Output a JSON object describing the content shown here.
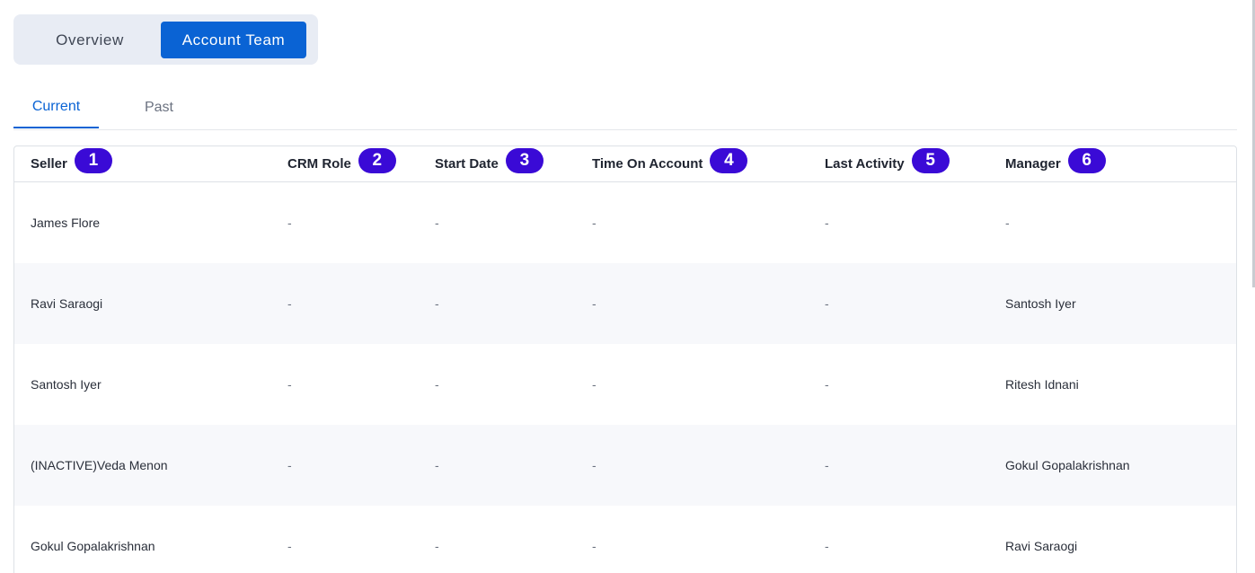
{
  "view_toggle": {
    "overview_label": "Overview",
    "account_team_label": "Account Team"
  },
  "subtabs": {
    "current_label": "Current",
    "past_label": "Past"
  },
  "table": {
    "columns": [
      {
        "label": "Seller",
        "badge": "1"
      },
      {
        "label": "CRM Role",
        "badge": "2"
      },
      {
        "label": "Start Date",
        "badge": "3"
      },
      {
        "label": "Time On Account",
        "badge": "4"
      },
      {
        "label": "Last Activity",
        "badge": "5"
      },
      {
        "label": "Manager",
        "badge": "6"
      }
    ],
    "rows": [
      {
        "seller": "James Flore",
        "crm_role": "-",
        "start_date": "-",
        "time_on_account": "-",
        "last_activity": "-",
        "manager": "-"
      },
      {
        "seller": "Ravi Saraogi",
        "crm_role": "-",
        "start_date": "-",
        "time_on_account": "-",
        "last_activity": "-",
        "manager": "Santosh Iyer"
      },
      {
        "seller": "Santosh Iyer",
        "crm_role": "-",
        "start_date": "-",
        "time_on_account": "-",
        "last_activity": "-",
        "manager": "Ritesh Idnani"
      },
      {
        "seller": "(INACTIVE)Veda Menon",
        "crm_role": "-",
        "start_date": "-",
        "time_on_account": "-",
        "last_activity": "-",
        "manager": "Gokul Gopalakrishnan"
      },
      {
        "seller": "Gokul Gopalakrishnan",
        "crm_role": "-",
        "start_date": "-",
        "time_on_account": "-",
        "last_activity": "-",
        "manager": "Ravi Saraogi"
      }
    ]
  },
  "colors": {
    "primary": "#0a63d4",
    "badge": "#3a0ad6",
    "toggle_bg": "#e8ecf4",
    "alt_row": "#f7f8fb"
  }
}
